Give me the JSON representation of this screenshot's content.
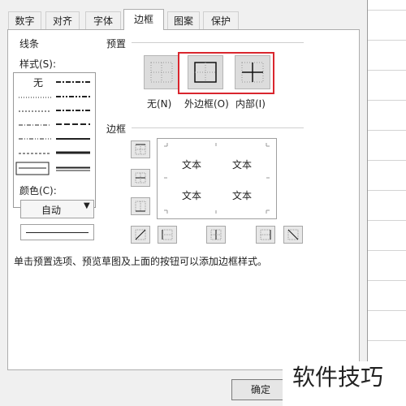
{
  "tabs": [
    {
      "label": "数字"
    },
    {
      "label": "对齐"
    },
    {
      "label": "字体"
    },
    {
      "label": "边框"
    },
    {
      "label": "图案"
    },
    {
      "label": "保护"
    }
  ],
  "active_tab": "边框",
  "line_group": {
    "title": "线条",
    "style_label": "样式(S):",
    "none_label": "无",
    "color_label": "颜色(C):",
    "color_value": "自动"
  },
  "preset_group": {
    "title": "预置",
    "none_label": "无(N)",
    "outline_label": "外边框(O)",
    "inside_label": "内部(I)"
  },
  "border_group": {
    "title": "边框",
    "preview_texts": [
      "文本",
      "文本",
      "文本",
      "文本"
    ]
  },
  "hint": "单击预置选项、预览草图及上面的按钮可以添加边框样式。",
  "buttons": {
    "ok": "确定"
  },
  "watermark": "软件技巧",
  "colors": {
    "highlight": "#d9262e",
    "panel": "#f0f0f0"
  }
}
